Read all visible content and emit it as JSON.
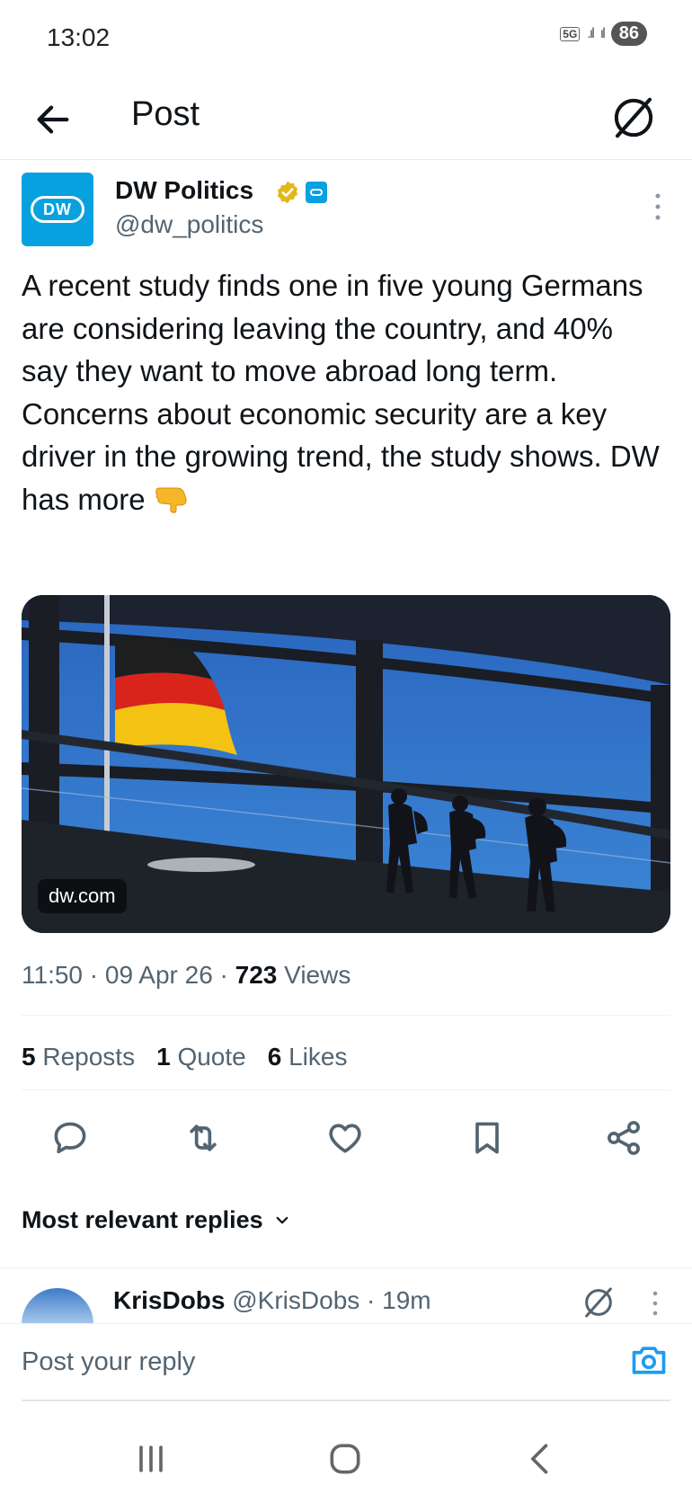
{
  "status_bar": {
    "time": "13:02",
    "network": "5G",
    "battery": "86"
  },
  "header": {
    "title": "Post",
    "back_icon": "arrow-left-icon",
    "grok_icon": "grok-icon"
  },
  "post": {
    "author_name": "DW Politics",
    "author_handle": "@dw_politics",
    "avatar_text": "DW",
    "text": "A recent study finds one in five young Germans are considering leaving the country, and 40% say they want to move abroad long term. Concerns about economic security are a key driver in the growing trend, the study shows. DW has more",
    "media_source": "dw.com",
    "time": "11:50",
    "date": "09 Apr 26",
    "views_count": "723",
    "views_label": "Views",
    "reposts_count": "5",
    "reposts_label": "Reposts",
    "quotes_count": "1",
    "quotes_label": "Quote",
    "likes_count": "6",
    "likes_label": "Likes"
  },
  "actions": [
    "reply-icon",
    "repost-icon",
    "like-icon",
    "bookmark-icon",
    "share-icon"
  ],
  "replies": {
    "sort_label": "Most relevant replies",
    "first": {
      "author": "KrisDobs",
      "handle": "@KrisDobs",
      "time": "19m"
    }
  },
  "compose": {
    "placeholder": "Post your reply"
  },
  "colors": {
    "text": "#0f1419",
    "secondary": "#536471",
    "brand_dw": "#08a1e0",
    "verified_gold": "#e2b719",
    "accent": "#1d9bf0"
  }
}
